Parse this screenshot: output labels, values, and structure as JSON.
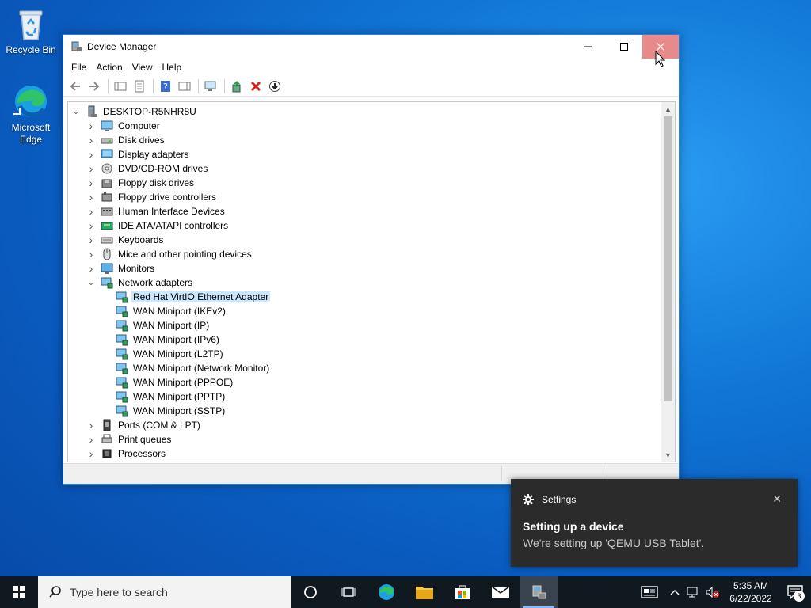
{
  "desktop": {
    "icons": [
      {
        "label": "Recycle Bin",
        "icon": "recycle-bin-icon"
      },
      {
        "label": "Microsoft Edge",
        "icon": "edge-icon"
      }
    ]
  },
  "window": {
    "title": "Device Manager",
    "menu": [
      "File",
      "Action",
      "View",
      "Help"
    ],
    "toolbar": [
      "back-icon",
      "forward-icon",
      "show-hide-console-tree-icon",
      "properties-icon",
      "help-icon",
      "action-pane-icon",
      "scan-hardware-icon",
      "update-driver-icon",
      "uninstall-icon",
      "disable-device-icon"
    ]
  },
  "tree": {
    "root": "DESKTOP-R5NHR8U",
    "categories": [
      {
        "label": "Computer",
        "icon": "computer-icon"
      },
      {
        "label": "Disk drives",
        "icon": "disk-drive-icon"
      },
      {
        "label": "Display adapters",
        "icon": "display-adapter-icon"
      },
      {
        "label": "DVD/CD-ROM drives",
        "icon": "dvd-icon"
      },
      {
        "label": "Floppy disk drives",
        "icon": "floppy-icon"
      },
      {
        "label": "Floppy drive controllers",
        "icon": "controller-icon"
      },
      {
        "label": "Human Interface Devices",
        "icon": "hid-icon"
      },
      {
        "label": "IDE ATA/ATAPI controllers",
        "icon": "ide-icon"
      },
      {
        "label": "Keyboards",
        "icon": "keyboard-icon"
      },
      {
        "label": "Mice and other pointing devices",
        "icon": "mouse-icon"
      },
      {
        "label": "Monitors",
        "icon": "monitor-icon"
      },
      {
        "label": "Network adapters",
        "icon": "network-icon"
      }
    ],
    "network_children": [
      "Red Hat VirtIO Ethernet Adapter",
      "WAN Miniport (IKEv2)",
      "WAN Miniport (IP)",
      "WAN Miniport (IPv6)",
      "WAN Miniport (L2TP)",
      "WAN Miniport (Network Monitor)",
      "WAN Miniport (PPPOE)",
      "WAN Miniport (PPTP)",
      "WAN Miniport (SSTP)"
    ],
    "after": [
      {
        "label": "Ports (COM & LPT)",
        "icon": "port-icon"
      },
      {
        "label": "Print queues",
        "icon": "printer-icon"
      },
      {
        "label": "Processors",
        "icon": "processor-icon"
      }
    ]
  },
  "toast": {
    "app": "Settings",
    "title": "Setting up a device",
    "body": "We're setting up 'QEMU USB Tablet'."
  },
  "taskbar": {
    "search_placeholder": "Type here to search",
    "time": "5:35 AM",
    "date": "6/22/2022",
    "notification_count": "3"
  },
  "colors": {
    "selection": "#cce8ff",
    "close_hover": "#e8898a",
    "taskbar": "#101820"
  }
}
